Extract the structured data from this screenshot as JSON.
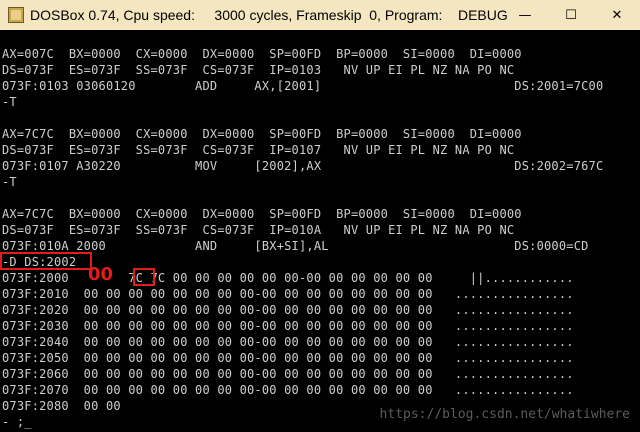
{
  "window": {
    "title": "DOSBox 0.74, Cpu speed:     3000 cycles, Frameskip  0, Program:    DEBUG",
    "controls": {
      "minimize": "—",
      "maximize": "☐",
      "close": "✕"
    }
  },
  "console": {
    "block1": [
      "AX=007C  BX=0000  CX=0000  DX=0000  SP=00FD  BP=0000  SI=0000  DI=0000",
      "DS=073F  ES=073F  SS=073F  CS=073F  IP=0103   NV UP EI PL NZ NA PO NC",
      "073F:0103 03060120        ADD     AX,[2001]                          DS:2001=7C00",
      "-T"
    ],
    "block2": [
      "AX=7C7C  BX=0000  CX=0000  DX=0000  SP=00FD  BP=0000  SI=0000  DI=0000",
      "DS=073F  ES=073F  SS=073F  CS=073F  IP=0107   NV UP EI PL NZ NA PO NC",
      "073F:0107 A30220          MOV     [2002],AX                          DS:2002=767C",
      "-T"
    ],
    "block3": [
      "AX=7C7C  BX=0000  CX=0000  DX=0000  SP=00FD  BP=0000  SI=0000  DI=0000",
      "DS=073F  ES=073F  SS=073F  CS=073F  IP=010A   NV UP EI PL NZ NA PO NC",
      "073F:010A 2000            AND     [BX+SI],AL                         DS:0000=CD"
    ],
    "dump_command": "-D DS:2002",
    "dump": [
      "073F:2000        7C 7C 00 00 00 00 00 00-00 00 00 00 00 00     ||............",
      "073F:2010  00 00 00 00 00 00 00 00-00 00 00 00 00 00 00 00   ................",
      "073F:2020  00 00 00 00 00 00 00 00-00 00 00 00 00 00 00 00   ................",
      "073F:2030  00 00 00 00 00 00 00 00-00 00 00 00 00 00 00 00   ................",
      "073F:2040  00 00 00 00 00 00 00 00-00 00 00 00 00 00 00 00   ................",
      "073F:2050  00 00 00 00 00 00 00 00-00 00 00 00 00 00 00 00   ................",
      "073F:2060  00 00 00 00 00 00 00 00-00 00 00 00 00 00 00 00   ................",
      "073F:2070  00 00 00 00 00 00 00 00-00 00 00 00 00 00 00 00   ................",
      "073F:2080  00 00"
    ],
    "prompt": "- ;_"
  },
  "annotation": {
    "handwritten": "00",
    "highlight_color": "#e21b1b"
  },
  "watermark": "https://blog.csdn.net/whatiwhere"
}
